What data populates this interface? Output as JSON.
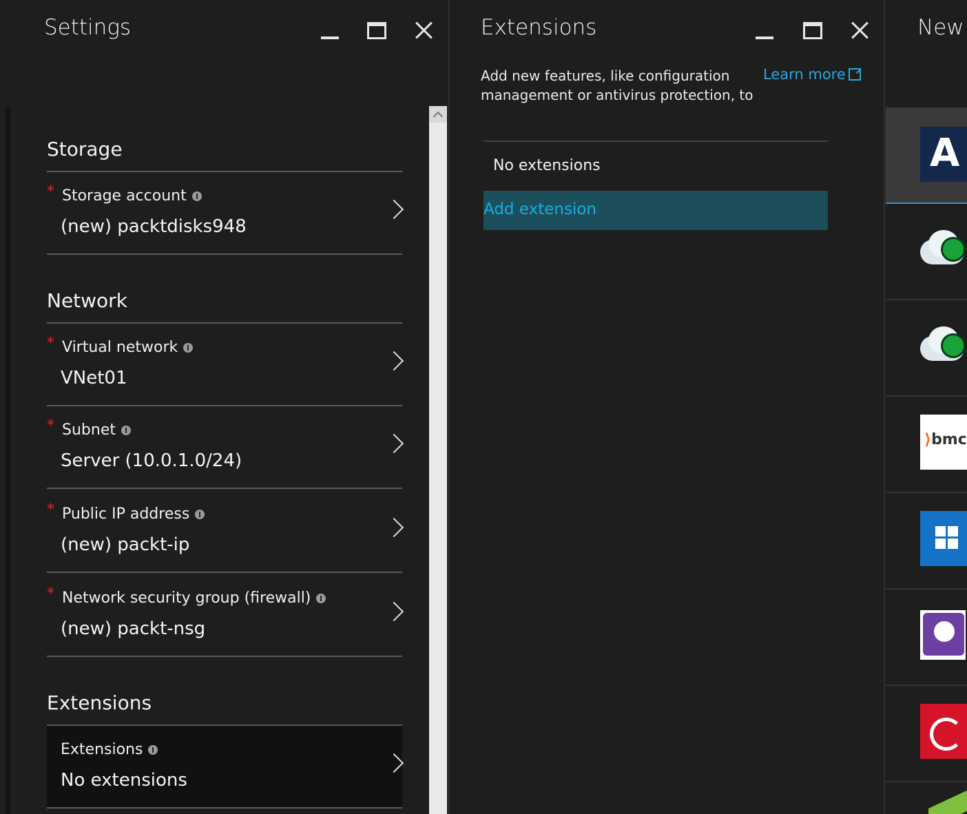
{
  "settings": {
    "title": "Settings",
    "sections": {
      "storage": {
        "header": "Storage"
      },
      "network": {
        "header": "Network"
      },
      "extensions": {
        "header": "Extensions"
      }
    },
    "rows": {
      "storage_account": {
        "label": "Storage account",
        "value": "(new) packtdisks948",
        "required": true
      },
      "virtual_network": {
        "label": "Virtual network",
        "value": "VNet01",
        "required": true
      },
      "subnet": {
        "label": "Subnet",
        "value": "Server (10.0.1.0/24)",
        "required": true
      },
      "public_ip": {
        "label": "Public IP address",
        "value": "(new) packt-ip",
        "required": true
      },
      "nsg": {
        "label": "Network security group (firewall)",
        "value": "(new) packt-nsg",
        "required": true
      },
      "extensions": {
        "label": "Extensions",
        "value": "No extensions",
        "required": false
      }
    },
    "required_mark": "*"
  },
  "extensions_blade": {
    "title": "Extensions",
    "description": "Add new features, like configuration management or antivirus protection, to",
    "learn_more": "Learn more",
    "empty_text": "No extensions",
    "add_button": "Add extension"
  },
  "new_blade": {
    "title": "New",
    "items": [
      {
        "icon": "letter-a-logo",
        "glyph": "A"
      },
      {
        "icon": "cloud-monitor-icon"
      },
      {
        "icon": "cloud-monitor-icon"
      },
      {
        "icon": "bmc-logo",
        "glyph": "bmc"
      },
      {
        "icon": "windows-logo"
      },
      {
        "icon": "datadog-logo"
      },
      {
        "icon": "trend-micro-logo"
      }
    ]
  },
  "colors": {
    "accent": "#2ba8d9",
    "selected_bg": "#1d4e5c",
    "required": "#e0282d",
    "blade_bg": "#1e1e1e"
  }
}
